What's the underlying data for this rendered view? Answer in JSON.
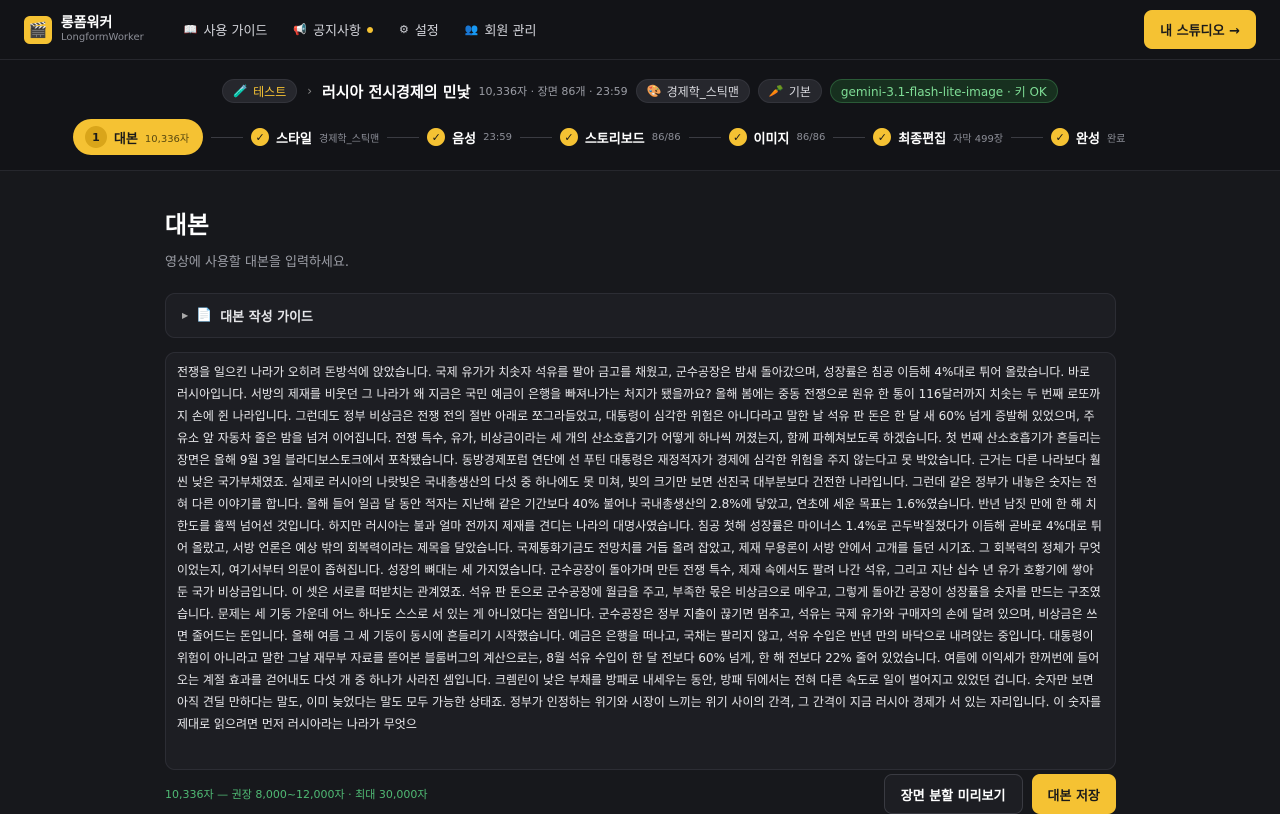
{
  "app": {
    "name": "롱폼워커",
    "subtitle": "LongformWorker",
    "logo_icon": "🎬"
  },
  "nav": [
    {
      "icon": "📖",
      "label": "사용 가이드"
    },
    {
      "icon": "📢",
      "label": "공지사항"
    },
    {
      "icon": "⚙",
      "label": "설정"
    },
    {
      "icon": "👥",
      "label": "회원 관리"
    }
  ],
  "studio_button": "내 스튜디오 →",
  "breadcrumb": {
    "folder_icon": "🧪",
    "folder": "테스트",
    "sep": "›",
    "title": "러시아 전시경제의 민낯",
    "meta": "10,336자 · 장면 86개 · 23:59",
    "style_icon": "🎨",
    "style": "경제학_스틱맨",
    "voice_icon": "🥕",
    "voice": "기본",
    "model": "gemini-3.1-flash-lite-image · 키 OK"
  },
  "steps": [
    {
      "num": "1",
      "label": "대본",
      "meta": "10,336자",
      "active": true
    },
    {
      "label": "스타일",
      "meta": "경제학_스틱맨"
    },
    {
      "label": "음성",
      "meta": "23:59"
    },
    {
      "label": "스토리보드",
      "meta": "86/86"
    },
    {
      "label": "이미지",
      "meta": "86/86"
    },
    {
      "label": "최종편집",
      "meta": "자막 499장"
    },
    {
      "label": "완성",
      "meta": "완료"
    }
  ],
  "page": {
    "title": "대본",
    "description": "영상에 사용할 대본을 입력하세요."
  },
  "guide": {
    "icon": "📄",
    "label": "대본 작성 가이드"
  },
  "script_text": "전쟁을 일으킨 나라가 오히려 돈방석에 앉았습니다. 국제 유가가 치솟자 석유를 팔아 금고를 채웠고, 군수공장은 밤새 돌아갔으며, 성장률은 침공 이듬해 4%대로 튀어 올랐습니다. 바로 러시아입니다. 서방의 제재를 비웃던 그 나라가 왜 지금은 국민 예금이 은행을 빠져나가는 처지가 됐을까요? 올해 봄에는 중동 전쟁으로 원유 한 통이 116달러까지 치솟는 두 번째 로또까지 손에 쥔 나라입니다. 그런데도 정부 비상금은 전쟁 전의 절반 아래로 쪼그라들었고, 대통령이 심각한 위험은 아니다라고 말한 날 석유 판 돈은 한 달 새 60% 넘게 증발해 있었으며, 주유소 앞 자동차 줄은 밤을 넘겨 이어집니다. 전쟁 특수, 유가, 비상금이라는 세 개의 산소호흡기가 어떻게 하나씩 꺼졌는지, 함께 파헤쳐보도록 하겠습니다. 첫 번째 산소호흡기가 흔들리는 장면은 올해 9월 3일 블라디보스토크에서 포착됐습니다. 동방경제포럼 연단에 선 푸틴 대통령은 재정적자가 경제에 심각한 위험을 주지 않는다고 못 박았습니다. 근거는 다른 나라보다 훨씬 낮은 국가부채였죠. 실제로 러시아의 나랏빚은 국내총생산의 다섯 중 하나에도 못 미쳐, 빚의 크기만 보면 선진국 대부분보다 건전한 나라입니다. 그런데 같은 정부가 내놓은 숫자는 전혀 다른 이야기를 합니다. 올해 들어 일곱 달 동안 적자는 지난해 같은 기간보다 40% 불어나 국내총생산의 2.8%에 닿았고, 연초에 세운 목표는 1.6%였습니다. 반년 남짓 만에 한 해 치 한도를 훌쩍 넘어선 것입니다. 하지만 러시아는 불과 얼마 전까지 제재를 견디는 나라의 대명사였습니다. 침공 첫해 성장률은 마이너스 1.4%로 곤두박질쳤다가 이듬해 곧바로 4%대로 튀어 올랐고, 서방 언론은 예상 밖의 회복력이라는 제목을 달았습니다. 국제통화기금도 전망치를 거듭 올려 잡았고, 제재 무용론이 서방 안에서 고개를 들던 시기죠. 그 회복력의 정체가 무엇이었는지, 여기서부터 의문이 좁혀집니다. 성장의 뼈대는 세 가지였습니다. 군수공장이 돌아가며 만든 전쟁 특수, 제재 속에서도 팔려 나간 석유, 그리고 지난 십수 년 유가 호황기에 쌓아 둔 국가 비상금입니다. 이 셋은 서로를 떠받치는 관계였죠. 석유 판 돈으로 군수공장에 월급을 주고, 부족한 몫은 비상금으로 메우고, 그렇게 돌아간 공장이 성장률을 숫자를 만드는 구조였습니다. 문제는 세 기둥 가운데 어느 하나도 스스로 서 있는 게 아니었다는 점입니다. 군수공장은 정부 지출이 끊기면 멈추고, 석유는 국제 유가와 구매자의 손에 달려 있으며, 비상금은 쓰면 줄어드는 돈입니다. 올해 여름 그 세 기둥이 동시에 흔들리기 시작했습니다. 예금은 은행을 떠나고, 국채는 팔리지 않고, 석유 수입은 반년 만의 바닥으로 내려앉는 중입니다. 대통령이 위험이 아니라고 말한 그날 재무부 자료를 뜯어본 블룸버그의 계산으로는, 8월 석유 수입이 한 달 전보다 60% 넘게, 한 해 전보다 22% 줄어 있었습니다. 여름에 이익세가 한꺼번에 들어오는 계절 효과를 걷어내도 다섯 개 중 하나가 사라진 셈입니다. 크렘린이 낮은 부채를 방패로 내세우는 동안, 방패 뒤에서는 전혀 다른 속도로 일이 벌어지고 있었던 겁니다. 숫자만 보면 아직 견딜 만하다는 말도, 이미 늦었다는 말도 모두 가능한 상태죠. 정부가 인정하는 위기와 시장이 느끼는 위기 사이의 간격, 그 간격이 지금 러시아 경제가 서 있는 자리입니다. 이 숫자를 제대로 읽으려면 먼저 러시아라는 나라가 무엇으",
  "counter": "10,336자 — 권장 8,000~12,000자 · 최대 30,000자",
  "buttons": {
    "preview": "장면 분할 미리보기",
    "save": "대본 저장"
  },
  "colors": {
    "accent": "#f5c233",
    "ok": "#7edc95",
    "counter": "#4fb873"
  }
}
